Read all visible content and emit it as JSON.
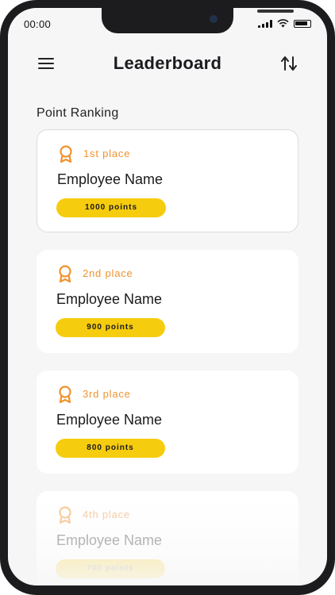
{
  "status_bar": {
    "time": "00:00"
  },
  "header": {
    "title": "Leaderboard"
  },
  "section": {
    "label": "Point Ranking"
  },
  "accent_color": "#f0922d",
  "badge_color": "#f6cc0e",
  "leaderboard": [
    {
      "place": "1st place",
      "name": "Employee Name",
      "points": "1000 points"
    },
    {
      "place": "2nd place",
      "name": "Employee Name",
      "points": "900 points"
    },
    {
      "place": "3rd place",
      "name": "Employee Name",
      "points": "800 points"
    },
    {
      "place": "4th place",
      "name": "Employee Name",
      "points": "700 points"
    }
  ],
  "icons": {
    "menu": "hamburger-menu-icon",
    "sort": "sort-arrows-icon",
    "award": "award-ribbon-icon"
  }
}
